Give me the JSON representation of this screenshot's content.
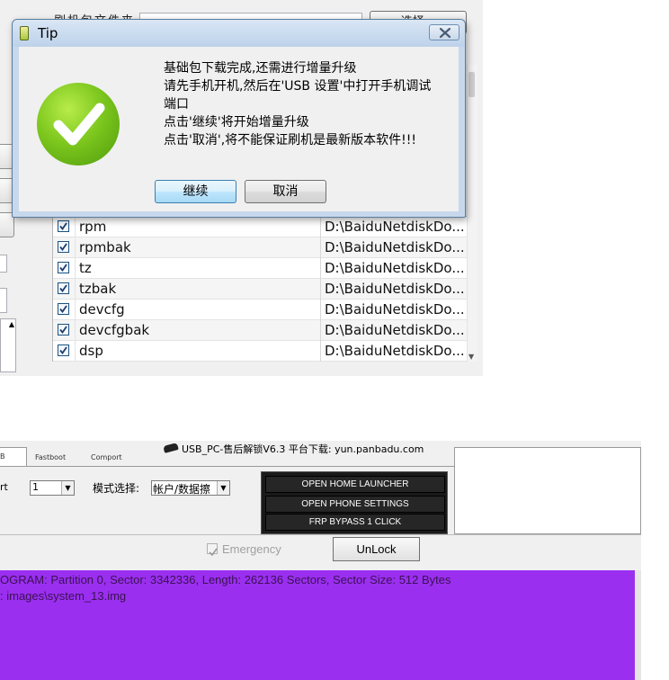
{
  "top_window": {
    "file_label": "刷机包文件夹",
    "browse_label": "选择...",
    "partitions": [
      {
        "name": "rpm",
        "path": "D:\\BaiduNetdiskDo...",
        "checked": true
      },
      {
        "name": "rpmbak",
        "path": "D:\\BaiduNetdiskDo...",
        "checked": true
      },
      {
        "name": "tz",
        "path": "D:\\BaiduNetdiskDo...",
        "checked": true
      },
      {
        "name": "tzbak",
        "path": "D:\\BaiduNetdiskDo...",
        "checked": true
      },
      {
        "name": "devcfg",
        "path": "D:\\BaiduNetdiskDo...",
        "checked": true
      },
      {
        "name": "devcfgbak",
        "path": "D:\\BaiduNetdiskDo...",
        "checked": true
      },
      {
        "name": "dsp",
        "path": "D:\\BaiduNetdiskDo...",
        "checked": true
      }
    ]
  },
  "dialog": {
    "title": "Tip",
    "icon": "success-check-icon",
    "message_lines": [
      "基础包下载完成,还需进行增量升级",
      "请先手机开机,然后在'USB 设置'中打开手机调试",
      "端口",
      "点击'继续'将开始增量升级",
      "点击'取消',将不能保证刷机是最新版本软件!!!"
    ],
    "continue_label": "继续",
    "cancel_label": "取消"
  },
  "bottom_window": {
    "title": "USB_PC-售后解锁V6.3    平台下载: yun.panbadu.com",
    "tabs": [
      "B",
      "Fastboot",
      "Comport"
    ],
    "port_label": "rt",
    "port_value": "1",
    "mode_label": "模式选择:",
    "mode_value": "帐户/数据擦",
    "buttons": [
      "OPEN HOME LAUNCHER",
      "OPEN PHONE SETTINGS",
      "FRP BYPASS 1 CLICK"
    ],
    "emergency_label": "Emergency",
    "emergency_checked": true,
    "unlock_label": "UnLock",
    "log_lines": [
      "OGRAM: Partition 0, Sector: 3342336, Length: 262136 Sectors, Sector Size: 512 Bytes",
      ": images\\system_13.img"
    ],
    "log_bg_color": "#9b2ff0"
  }
}
